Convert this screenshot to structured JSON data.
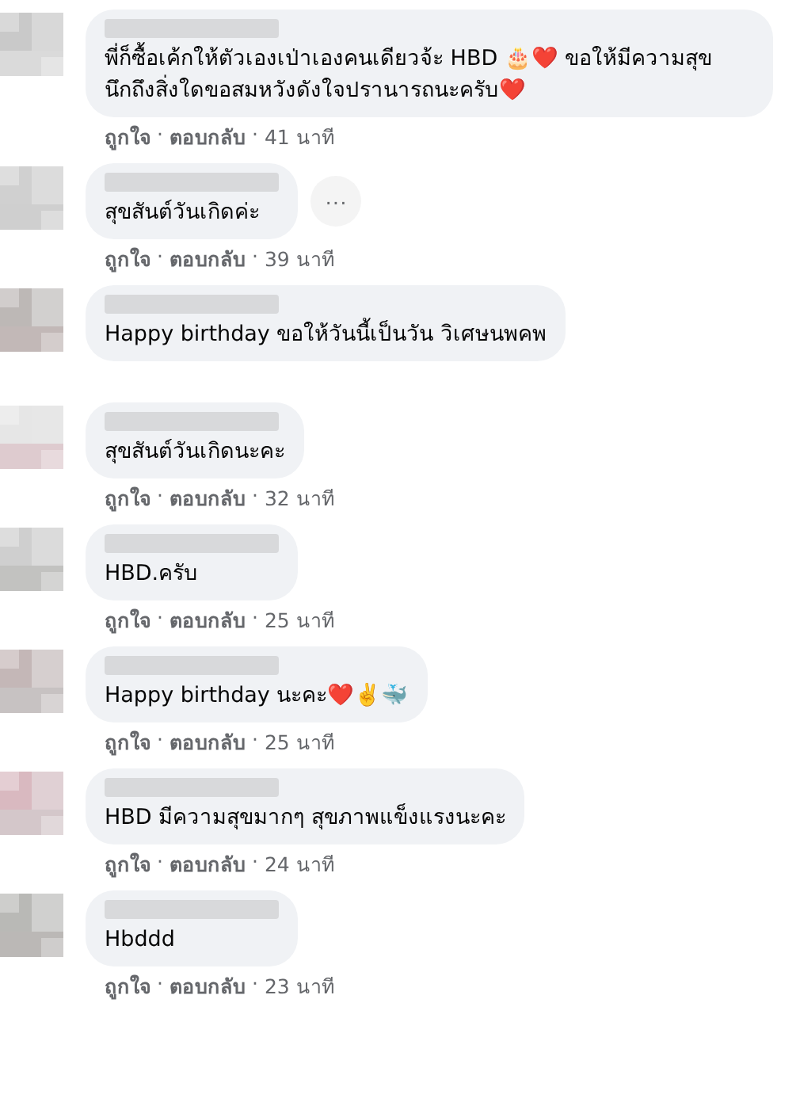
{
  "comments": [
    {
      "text": "พี่ก็ซื้อเค้กให้ตัวเองเป่าเองคนเดียวจ้ะ HBD 🎂❤️ ขอให้มีความสุข นึกถึงสิ่งใดขอสมหวังดังใจปรานารถนะครับ❤️",
      "more_button": false,
      "footer": [
        {
          "kind": "link",
          "text": "ถูกใจ"
        },
        {
          "kind": "separator",
          "text": "·"
        },
        {
          "kind": "link",
          "text": "ตอบกลับ"
        },
        {
          "kind": "separator",
          "text": "·"
        },
        {
          "kind": "time",
          "text": "41 นาที"
        }
      ]
    },
    {
      "text": "สุขสันต์วันเกิดค่ะ",
      "more_button": true,
      "more_label": "···",
      "footer": [
        {
          "kind": "link",
          "text": "ถูกใจ"
        },
        {
          "kind": "separator",
          "text": "·"
        },
        {
          "kind": "link",
          "text": "ตอบกลับ"
        },
        {
          "kind": "separator",
          "text": "·"
        },
        {
          "kind": "time",
          "text": "39 นาที"
        }
      ]
    },
    {
      "text": "Happy birthday ขอให้วันนี้เป็นวัน วิเศษนพคพ",
      "more_button": false
    },
    {
      "text": "สุขสันต์วันเกิดนะคะ",
      "more_button": false,
      "footer": [
        {
          "kind": "link",
          "text": "ถูกใจ"
        },
        {
          "kind": "separator",
          "text": "·"
        },
        {
          "kind": "link",
          "text": "ตอบกลับ"
        },
        {
          "kind": "separator",
          "text": "·"
        },
        {
          "kind": "time",
          "text": "32 นาที"
        }
      ]
    },
    {
      "text": "HBD.ครับ",
      "more_button": false,
      "footer": [
        {
          "kind": "link",
          "text": "ถูกใจ"
        },
        {
          "kind": "separator",
          "text": "·"
        },
        {
          "kind": "link",
          "text": "ตอบกลับ"
        },
        {
          "kind": "separator",
          "text": "·"
        },
        {
          "kind": "time",
          "text": "25 นาที"
        }
      ]
    },
    {
      "text": "Happy birthday นะคะ❤️✌️🐳",
      "more_button": false,
      "footer": [
        {
          "kind": "link",
          "text": "ถูกใจ"
        },
        {
          "kind": "separator",
          "text": "·"
        },
        {
          "kind": "link",
          "text": "ตอบกลับ"
        },
        {
          "kind": "separator",
          "text": "·"
        },
        {
          "kind": "time",
          "text": "25 นาที"
        }
      ]
    },
    {
      "text": "HBD มีความสุขมากๆ สุขภาพแข็งแรงนะคะ",
      "more_button": false,
      "footer": [
        {
          "kind": "link",
          "text": "ถูกใจ"
        },
        {
          "kind": "separator",
          "text": "·"
        },
        {
          "kind": "link",
          "text": "ตอบกลับ"
        },
        {
          "kind": "separator",
          "text": "·"
        },
        {
          "kind": "time",
          "text": "24 นาที"
        }
      ]
    },
    {
      "text": "Hbddd",
      "more_button": false,
      "footer": [
        {
          "kind": "link",
          "text": "ถูกใจ"
        },
        {
          "kind": "separator",
          "text": "·"
        },
        {
          "kind": "link",
          "text": "ตอบกลับ"
        },
        {
          "kind": "separator",
          "text": "·"
        },
        {
          "kind": "time",
          "text": "23 นาที"
        }
      ]
    }
  ]
}
